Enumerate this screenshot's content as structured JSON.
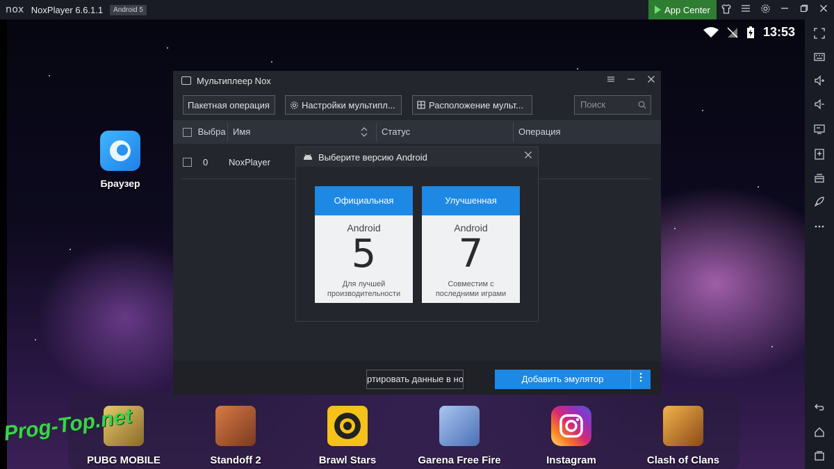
{
  "titlebar": {
    "logo": "nox",
    "title": "NoxPlayer 6.6.1.1",
    "android_badge": "Android 5",
    "app_center": "App Center"
  },
  "status": {
    "time": "13:53"
  },
  "desktop": {
    "apps": [
      {
        "label": "Браузер",
        "icon": "browser-icon"
      }
    ]
  },
  "dock": {
    "apps": [
      {
        "label": "PUBG MOBILE",
        "icon": "pubg-icon",
        "color": "#d9b24a"
      },
      {
        "label": "Standoff 2",
        "icon": "standoff-icon",
        "color": "#c0603a"
      },
      {
        "label": "Brawl Stars",
        "icon": "brawl-stars-icon",
        "color": "#f4c21a"
      },
      {
        "label": "Garena Free Fire",
        "icon": "free-fire-icon",
        "color": "#6a8fd6"
      },
      {
        "label": "Instagram",
        "icon": "instagram-icon",
        "color": "#d62976"
      },
      {
        "label": "Clash of Clans",
        "icon": "clash-of-clans-icon",
        "color": "#e0902a"
      }
    ]
  },
  "watermark": "Prog-Top.net",
  "multiplayer": {
    "title": "Мультиплеер Nox",
    "toolbar": {
      "batch": "Пакетная операция",
      "settings": "Настройки мультипл...",
      "layout": "Расположение мульт..."
    },
    "search_placeholder": "Поиск",
    "columns": {
      "select": "Выбра",
      "name": "Имя",
      "status": "Статус",
      "operation": "Операция"
    },
    "rows": [
      {
        "index": "0",
        "name": "NoxPlayer"
      }
    ],
    "footer": {
      "export": "ртировать данные в ное",
      "add": "Добавить эмулятор"
    }
  },
  "dialog": {
    "title": "Выберите версию Android",
    "cards": [
      {
        "header": "Официальная",
        "os": "Android",
        "version": "5",
        "desc": "Для лучшей производительности"
      },
      {
        "header": "Улучшенная",
        "os": "Android",
        "version": "7",
        "desc": "Совместим с последними играми"
      }
    ]
  }
}
